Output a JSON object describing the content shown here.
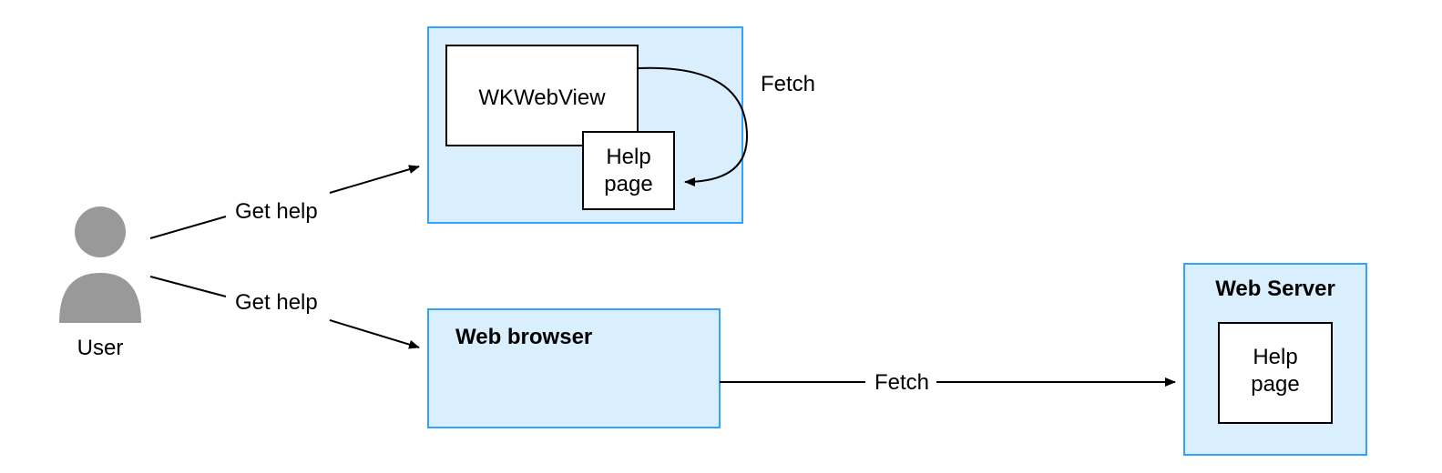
{
  "user": {
    "label": "User"
  },
  "actions": {
    "get_help_top": "Get help",
    "get_help_bottom": "Get help",
    "fetch_loop": "Fetch",
    "fetch_remote": "Fetch"
  },
  "wkwebview": {
    "label": "WKWebView",
    "help_page_line1": "Help",
    "help_page_line2": "page"
  },
  "web_browser": {
    "label": "Web browser"
  },
  "web_server": {
    "label": "Web Server",
    "help_page_line1": "Help",
    "help_page_line2": "page"
  },
  "colors": {
    "panel_fill": "#daeffd",
    "panel_stroke": "#33a2ff"
  }
}
